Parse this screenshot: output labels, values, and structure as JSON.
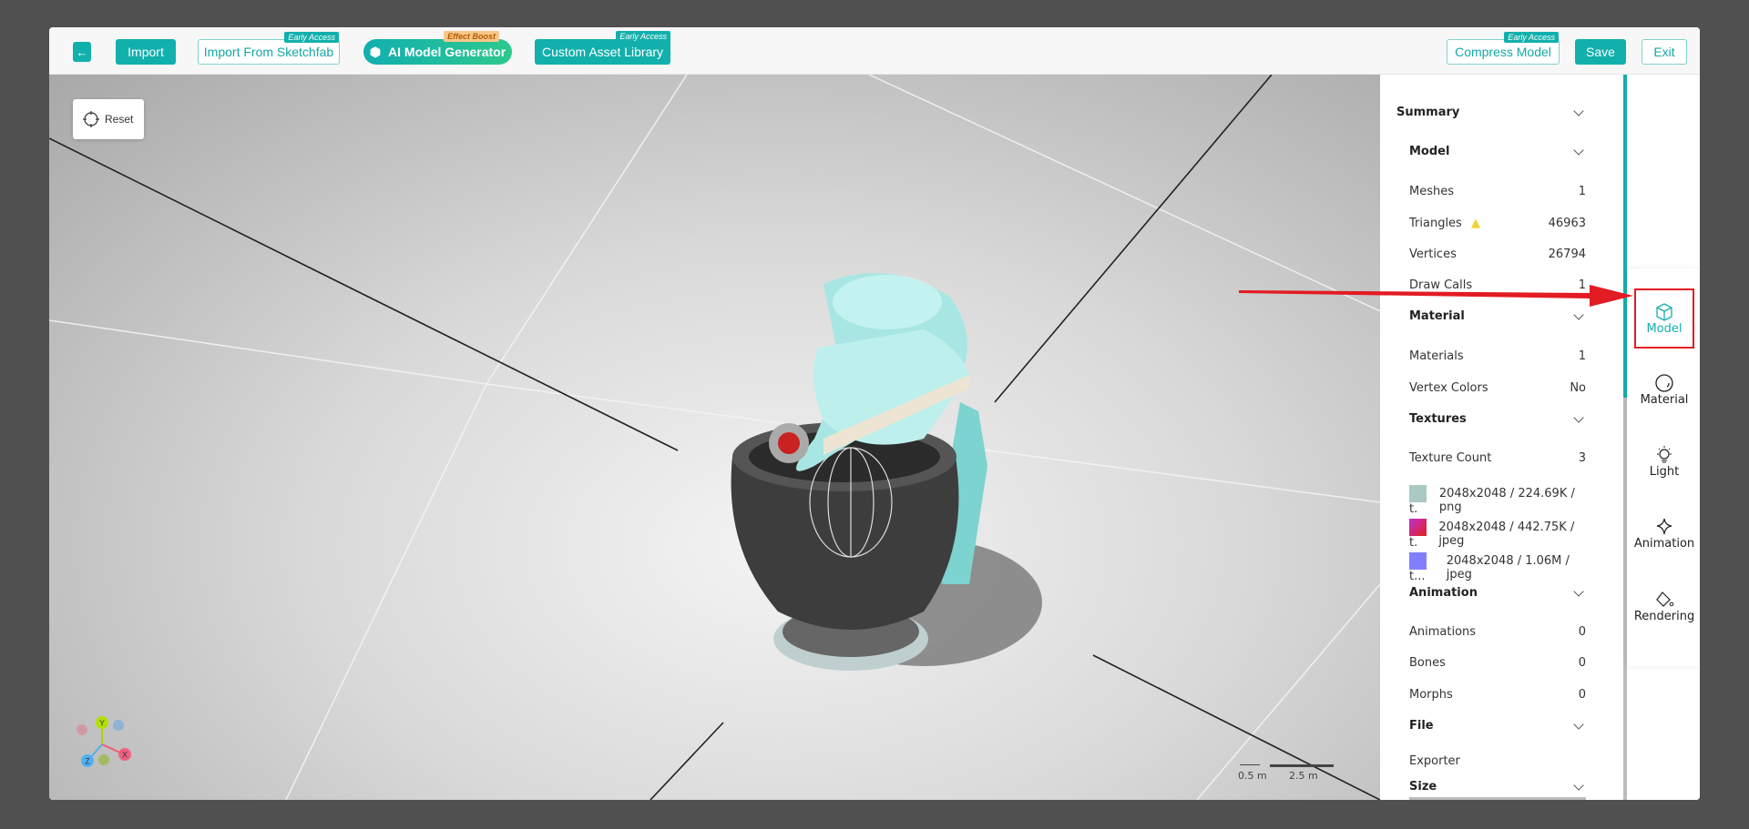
{
  "toolbar": {
    "import": "Import",
    "import_sketchfab": "Import From Sketchfab",
    "ai_generator": "AI Model Generator",
    "custom_library": "Custom Asset Library",
    "compress": "Compress Model",
    "save": "Save",
    "exit": "Exit",
    "badge_early": "Early Access",
    "badge_effect": "Effect Boost"
  },
  "viewport": {
    "reset": "Reset",
    "scale_small": "0.5 m",
    "scale_large": "2.5 m",
    "axes": {
      "x": "X",
      "y": "Y",
      "z": "Z"
    }
  },
  "panel": {
    "summary": "Summary",
    "model": {
      "title": "Model",
      "meshes_label": "Meshes",
      "meshes": "1",
      "triangles_label": "Triangles",
      "triangles": "46963",
      "vertices_label": "Vertices",
      "vertices": "26794",
      "drawcalls_label": "Draw Calls",
      "drawcalls": "1"
    },
    "material": {
      "title": "Material",
      "materials_label": "Materials",
      "materials": "1",
      "vertex_colors_label": "Vertex Colors",
      "vertex_colors": "No"
    },
    "textures": {
      "title": "Textures",
      "count_label": "Texture Count",
      "count": "3",
      "items": [
        {
          "name": "t.",
          "info": "2048x2048 / 224.69K / png",
          "color": "#a9c9c2"
        },
        {
          "name": "t.",
          "info": "2048x2048 / 442.75K / jpeg",
          "color": "#c0287a"
        },
        {
          "name": "t...",
          "info": "2048x2048 / 1.06M / jpeg",
          "color": "#8080ff"
        }
      ]
    },
    "animation": {
      "title": "Animation",
      "animations_label": "Animations",
      "animations": "0",
      "bones_label": "Bones",
      "bones": "0",
      "morphs_label": "Morphs",
      "morphs": "0"
    },
    "file": {
      "title": "File",
      "exporter_label": "Exporter"
    },
    "size": {
      "title": "Size"
    }
  },
  "rail": {
    "model": "Model",
    "material": "Material",
    "light": "Light",
    "animation": "Animation",
    "rendering": "Rendering"
  },
  "colors": {
    "accent": "#12b0ac",
    "highlight": "#e31b23",
    "warning": "#f2d22e"
  }
}
